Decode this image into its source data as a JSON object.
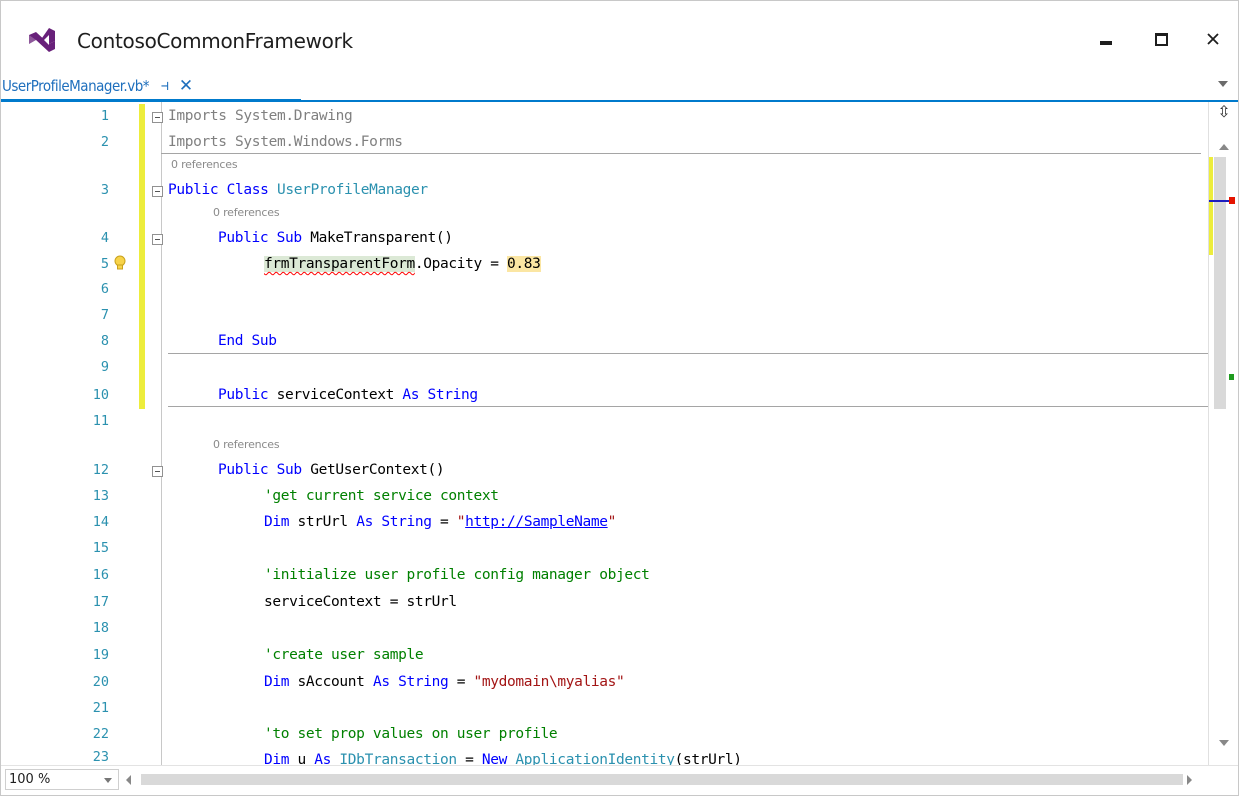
{
  "window": {
    "title": "ContosoCommonFramework",
    "logo_icon": "visual-studio-logo-icon",
    "controls": [
      "minimize-icon",
      "maximize-icon",
      "close-icon"
    ]
  },
  "tab": {
    "label": "UserProfileManager.vb*",
    "pin_glyph": "⊣",
    "close_glyph": "✕",
    "accent": "#007acc"
  },
  "gutter": {
    "line_numbers": [
      "1",
      "2",
      "3",
      "4",
      "5",
      "6",
      "7",
      "8",
      "9",
      "10",
      "11",
      "12",
      "13",
      "14",
      "15",
      "16",
      "17",
      "18",
      "19",
      "20",
      "21",
      "22",
      "23"
    ]
  },
  "code": {
    "refs_label": "0 references",
    "l1": {
      "kw": "Imports",
      "rest": " System.Drawing"
    },
    "l2": {
      "kw": "Imports",
      "rest": " System.Windows.Forms"
    },
    "l3": {
      "kw1": "Public",
      "kw2": " Class ",
      "name": "UserProfileManager"
    },
    "l4": {
      "kw1": "Public",
      "kw2": " Sub ",
      "rest": "MakeTransparent()"
    },
    "l5": {
      "ident": "frmTransparentForm",
      "rest": ".Opacity = ",
      "num": "0.83"
    },
    "l8": {
      "kw": "End Sub"
    },
    "l10": {
      "kw1": "Public",
      "mid": " serviceContext ",
      "kw2": "As",
      "kw3": " String"
    },
    "l12": {
      "kw1": "Public",
      "kw2": " Sub ",
      "rest": "GetUserContext()"
    },
    "l13": {
      "comment": "'get current service context"
    },
    "l14": {
      "kw1": "Dim",
      "mid": " strUrl ",
      "kw2": "As",
      "kw3": " String",
      "eq": " = ",
      "q1": "\"",
      "link": "http://SampleName",
      "q2": "\""
    },
    "l16": {
      "comment": "'initialize user profile config manager object"
    },
    "l17": {
      "text": "serviceContext = strUrl"
    },
    "l19": {
      "comment": "'create user sample"
    },
    "l20": {
      "kw1": "Dim",
      "mid": " sAccount ",
      "kw2": "As",
      "kw3": " String",
      "eq": " = ",
      "str": "\"mydomain\\myalias\""
    },
    "l22": {
      "comment": "'to set prop values on user profile"
    },
    "l23": {
      "kw1": "Dim",
      "mid": " u ",
      "kw2": "As",
      "typ": " IDbTransaction",
      "eq": " = ",
      "kw3": "New",
      "typ2": " ApplicationIdentity",
      "rest": "(strUrl)"
    }
  },
  "status": {
    "zoom": "100 %"
  },
  "colors": {
    "keyword": "#0000ff",
    "type": "#2b91af",
    "comment": "#008000",
    "string": "#a31515",
    "change_bar": "#eded3c"
  }
}
